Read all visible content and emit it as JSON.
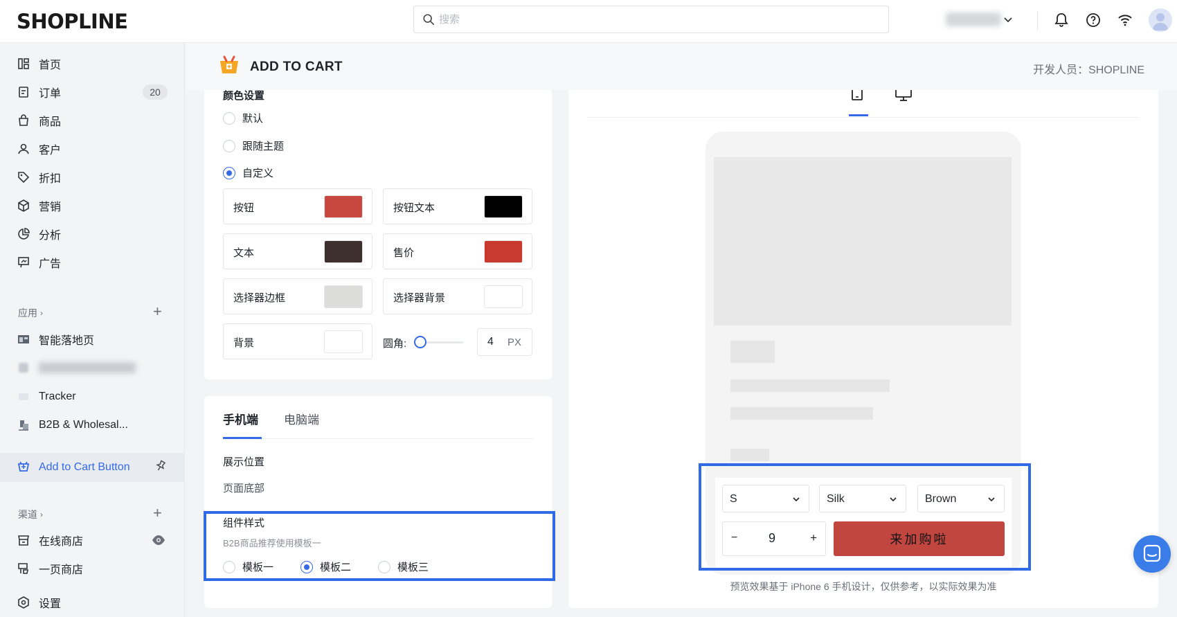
{
  "brand": "SHOPLINE",
  "search": {
    "placeholder": "搜索"
  },
  "sidebar": {
    "items": [
      {
        "label": "首页"
      },
      {
        "label": "订单",
        "badge": "20"
      },
      {
        "label": "商品"
      },
      {
        "label": "客户"
      },
      {
        "label": "折扣"
      },
      {
        "label": "营销"
      },
      {
        "label": "分析"
      },
      {
        "label": "广告"
      }
    ],
    "apps_section": "应用",
    "apps": [
      {
        "label": "智能落地页"
      },
      {
        "label": "Tracker"
      },
      {
        "label": "B2B & Wholesal..."
      },
      {
        "label": "Add to Cart Button"
      }
    ],
    "channels_section": "渠道",
    "channels": [
      {
        "label": "在线商店"
      },
      {
        "label": "一页商店"
      }
    ],
    "settings": "设置"
  },
  "header": {
    "title": "ADD TO CART",
    "developer": "开发人员：SHOPLINE"
  },
  "colors_section": {
    "title": "颜色设置",
    "options": [
      "默认",
      "跟随主题",
      "自定义"
    ],
    "selected": "自定义",
    "swatches": [
      {
        "label": "按钮",
        "color": "#c8473f"
      },
      {
        "label": "按钮文本",
        "color": "#000000"
      },
      {
        "label": "文本",
        "color": "#3f3030"
      },
      {
        "label": "售价",
        "color": "#c8392e"
      },
      {
        "label": "选择器边框",
        "color": "#dcdcd8"
      },
      {
        "label": "选择器背景",
        "color": "#ffffff"
      },
      {
        "label": "背景",
        "color": "#ffffff"
      }
    ],
    "radius_label": "圆角:",
    "radius_value": "4",
    "radius_unit": "PX"
  },
  "display_section": {
    "tabs": [
      "手机端",
      "电脑端"
    ],
    "position_label": "展示位置",
    "position_value": "页面底部",
    "style_label": "组件样式",
    "style_hint": "B2B商品推荐使用模板一",
    "templates": [
      "模板一",
      "模板二",
      "模板三"
    ],
    "selected_template": "模板二"
  },
  "preview": {
    "selectors": [
      "S",
      "Silk",
      "Brown"
    ],
    "quantity": "9",
    "minus": "−",
    "plus": "+",
    "cart_button": "来加购啦",
    "note": "预览效果基于 iPhone 6 手机设计，仅供参考，以实际效果为准"
  }
}
